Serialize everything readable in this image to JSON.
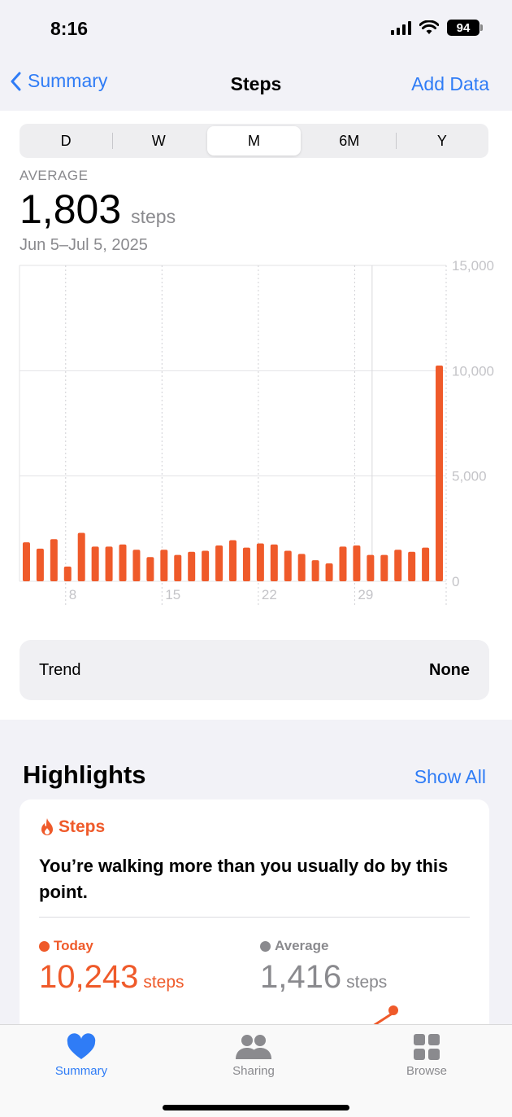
{
  "status_bar": {
    "time": "8:16",
    "battery": "94"
  },
  "nav": {
    "back_label": "Summary",
    "title": "Steps",
    "action_label": "Add Data"
  },
  "segments": [
    {
      "label": "D",
      "active": false
    },
    {
      "label": "W",
      "active": false
    },
    {
      "label": "M",
      "active": true
    },
    {
      "label": "6M",
      "active": false
    },
    {
      "label": "Y",
      "active": false
    }
  ],
  "summary": {
    "label": "AVERAGE",
    "value": "1,803",
    "unit": "steps",
    "date_range": "Jun 5–Jul 5, 2025"
  },
  "chart_data": {
    "type": "bar",
    "x": [
      "Jun 5",
      "Jun 6",
      "Jun 7",
      "Jun 8",
      "Jun 9",
      "Jun 10",
      "Jun 11",
      "Jun 12",
      "Jun 13",
      "Jun 14",
      "Jun 15",
      "Jun 16",
      "Jun 17",
      "Jun 18",
      "Jun 19",
      "Jun 20",
      "Jun 21",
      "Jun 22",
      "Jun 23",
      "Jun 24",
      "Jun 25",
      "Jun 26",
      "Jun 27",
      "Jun 28",
      "Jun 29",
      "Jun 30",
      "Jul 1",
      "Jul 2",
      "Jul 3",
      "Jul 4",
      "Jul 5"
    ],
    "values": [
      1850,
      1550,
      2000,
      700,
      2300,
      1650,
      1650,
      1750,
      1500,
      1150,
      1500,
      1250,
      1400,
      1450,
      1700,
      1950,
      1600,
      1800,
      1750,
      1450,
      1300,
      1000,
      850,
      1650,
      1700,
      1250,
      1250,
      1500,
      1400,
      1600,
      10243
    ],
    "x_tick_labels": [
      "8",
      "15",
      "22",
      "29"
    ],
    "y_tick_labels": [
      "15,000",
      "10,000",
      "5,000",
      "0"
    ],
    "ylim": [
      0,
      15000
    ],
    "color": "#ef5a2a",
    "grid": true
  },
  "trend": {
    "label": "Trend",
    "value": "None"
  },
  "highlights": {
    "heading": "Highlights",
    "show_all": "Show All",
    "card": {
      "category": "Steps",
      "text": "You’re walking more than you usually do by this point.",
      "today": {
        "label": "Today",
        "value": "10,243",
        "unit": "steps"
      },
      "average": {
        "label": "Average",
        "value": "1,416",
        "unit": "steps"
      }
    }
  },
  "tabs": [
    {
      "label": "Summary",
      "icon": "heart-icon",
      "active": true
    },
    {
      "label": "Sharing",
      "icon": "people-icon",
      "active": false
    },
    {
      "label": "Browse",
      "icon": "grid-icon",
      "active": false
    }
  ],
  "colors": {
    "accent": "#2f7cf6",
    "steps": "#ef5a2a",
    "muted": "#8a8a8e"
  }
}
